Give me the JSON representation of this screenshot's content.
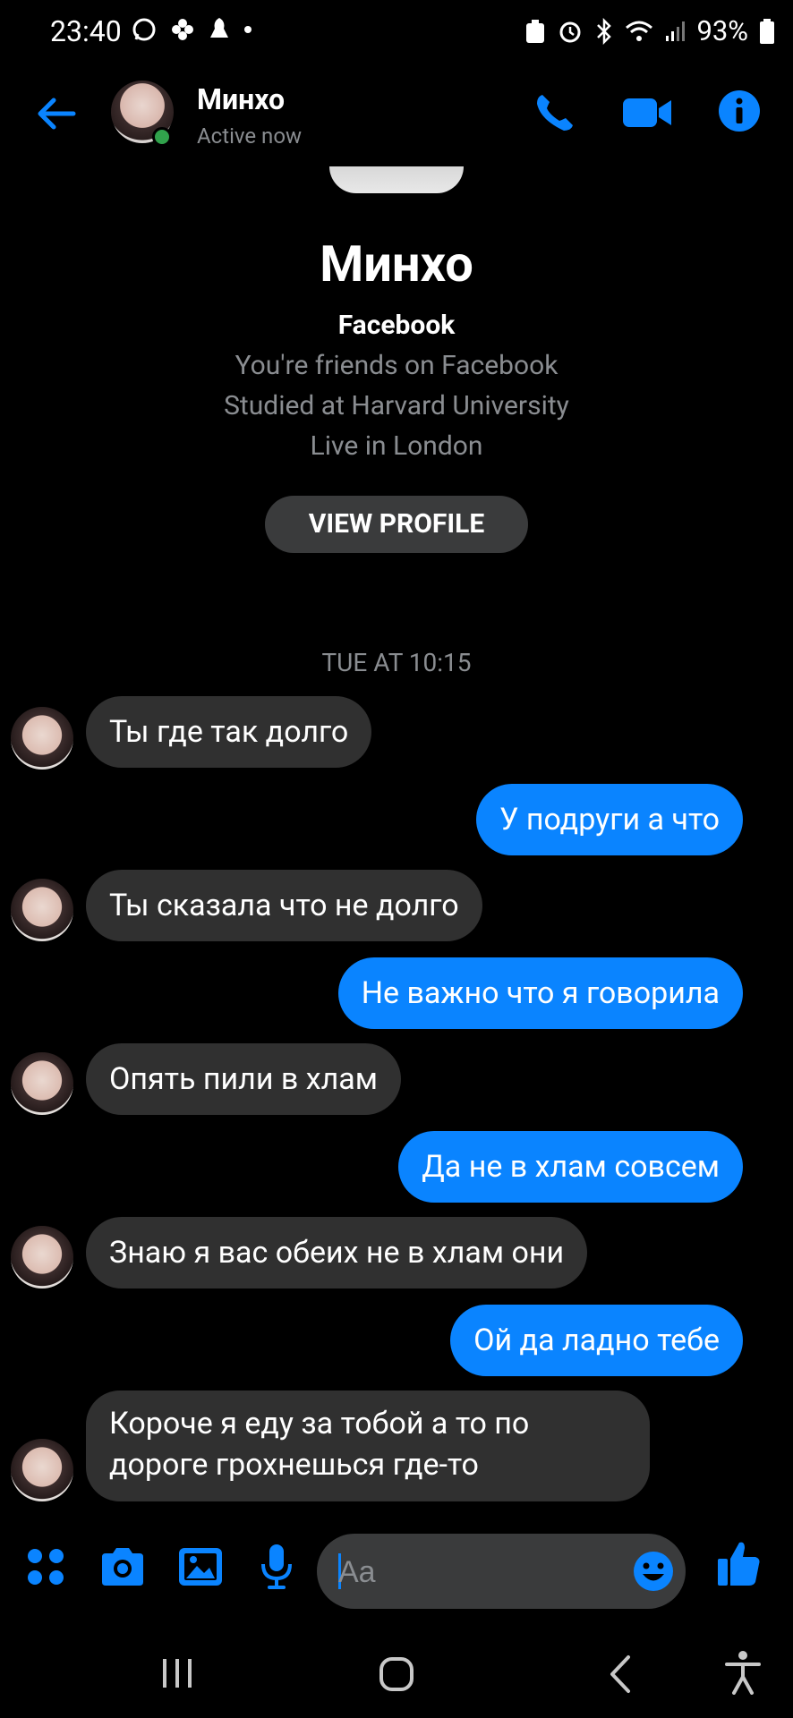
{
  "status_bar": {
    "time": "23:40",
    "battery": "93%"
  },
  "header": {
    "name": "Минхо",
    "status": "Active now"
  },
  "profile": {
    "name": "Минхо",
    "platform": "Facebook",
    "lines": [
      "You're friends on Facebook",
      "Studied at Harvard University",
      "Live in London"
    ],
    "button": "VIEW PROFILE"
  },
  "timestamp": "TUE AT 10:15",
  "messages": [
    {
      "side": "in",
      "text": "Ты где так долго"
    },
    {
      "side": "out",
      "text": "У подруги а что"
    },
    {
      "side": "in",
      "text": "Ты сказала что не долго"
    },
    {
      "side": "out",
      "text": "Не важно что я говорила"
    },
    {
      "side": "in",
      "text": "Опять пили в хлам"
    },
    {
      "side": "out",
      "text": "Да не в хлам совсем"
    },
    {
      "side": "in",
      "text": "Знаю я вас обеих не в хлам они"
    },
    {
      "side": "out",
      "text": "Ой да ладно тебе"
    },
    {
      "side": "in",
      "text": "Короче я еду за тобой а то по",
      "text2": "дороге грохнешься где-то"
    }
  ],
  "composer": {
    "placeholder": "Aa"
  },
  "colors": {
    "accent": "#0a84ff",
    "incoming_bubble": "#303030",
    "online": "#31a24c"
  }
}
